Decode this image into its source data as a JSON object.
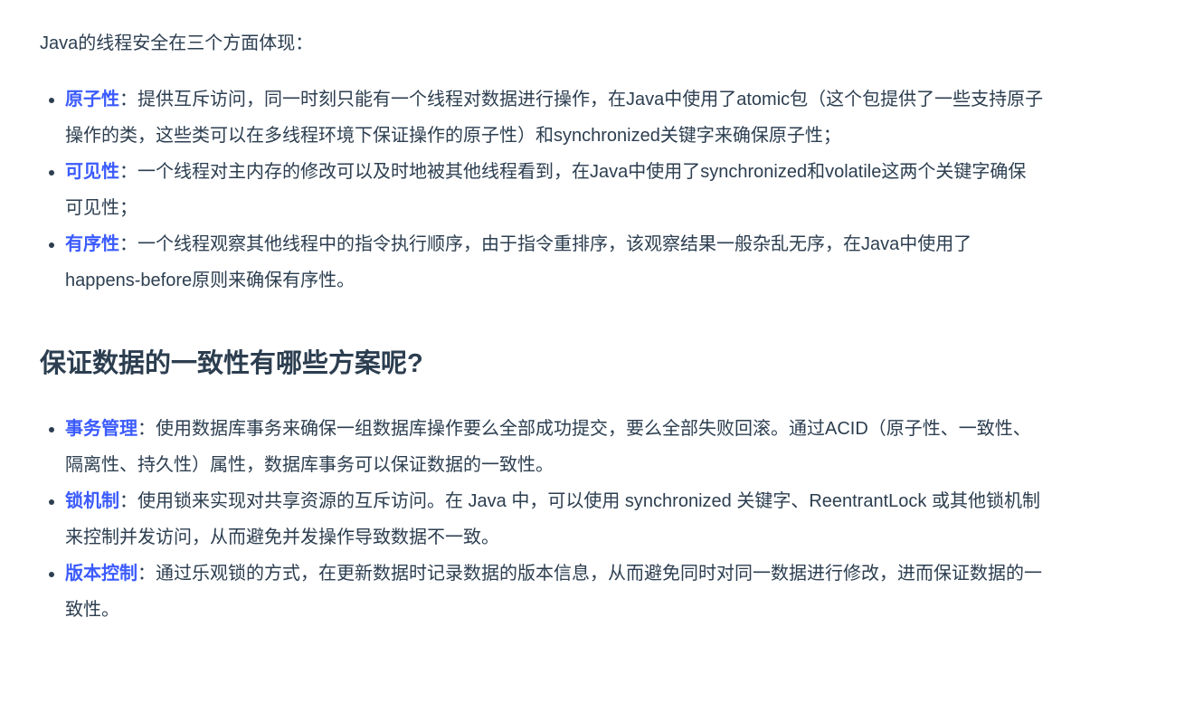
{
  "intro": "Java的线程安全在三个方面体现：",
  "safety_items": [
    {
      "term": "原子性",
      "text": "：提供互斥访问，同一时刻只能有一个线程对数据进行操作，在Java中使用了atomic包（这个包提供了一些支持原子操作的类，这些类可以在多线程环境下保证操作的原子性）和synchronized关键字来确保原子性；"
    },
    {
      "term": "可见性",
      "text": "：一个线程对主内存的修改可以及时地被其他线程看到，在Java中使用了synchronized和volatile这两个关键字确保可见性；"
    },
    {
      "term": "有序性",
      "text": "：一个线程观察其他线程中的指令执行顺序，由于指令重排序，该观察结果一般杂乱无序，在Java中使用了happens-before原则来确保有序性。"
    }
  ],
  "heading": "保证数据的一致性有哪些方案呢?",
  "consistency_items": [
    {
      "term": "事务管理",
      "text": "：使用数据库事务来确保一组数据库操作要么全部成功提交，要么全部失败回滚。通过ACID（原子性、一致性、隔离性、持久性）属性，数据库事务可以保证数据的一致性。"
    },
    {
      "term": "锁机制",
      "text": "：使用锁来实现对共享资源的互斥访问。在 Java 中，可以使用 synchronized 关键字、ReentrantLock 或其他锁机制来控制并发访问，从而避免并发操作导致数据不一致。"
    },
    {
      "term": "版本控制",
      "text": "：通过乐观锁的方式，在更新数据时记录数据的版本信息，从而避免同时对同一数据进行修改，进而保证数据的一致性。"
    }
  ],
  "colors": {
    "text": "#2c3e50",
    "accent": "#3b5bfd"
  }
}
